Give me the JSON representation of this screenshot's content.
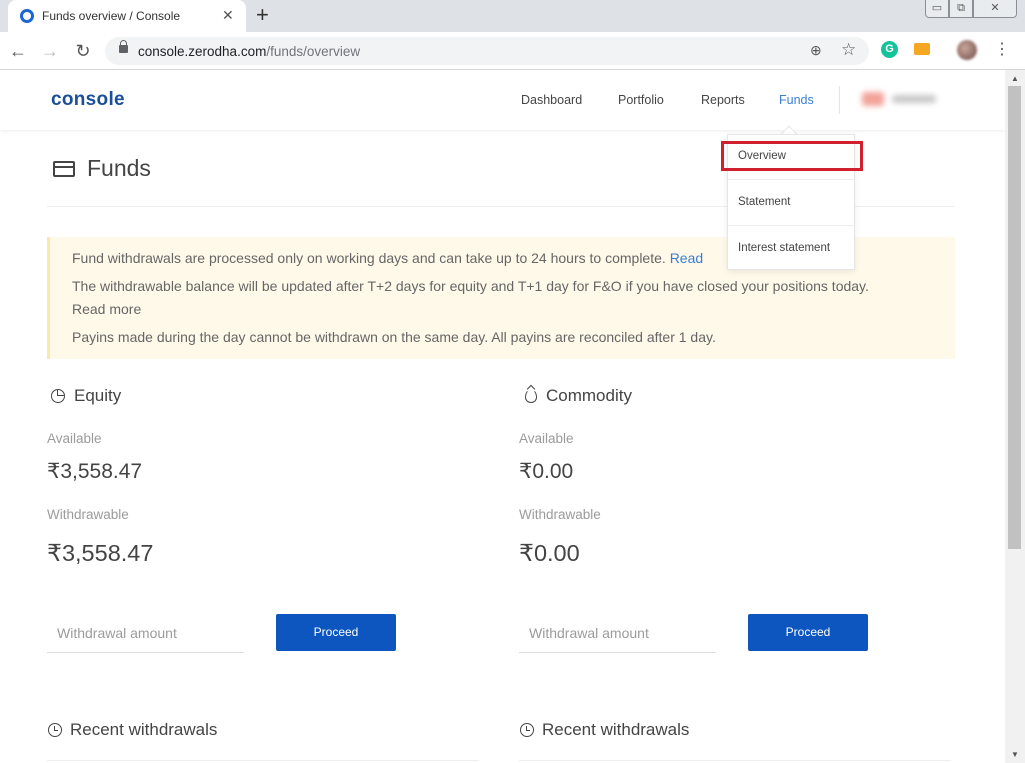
{
  "browser": {
    "tab_title": "Funds overview / Console",
    "tab_close": "✕",
    "new_tab": "+",
    "window_controls": {
      "minimize": "▭",
      "maximize": "⧉",
      "close": "✕"
    },
    "back": "←",
    "forward": "→",
    "reload": "↻",
    "url_host": "console.zerodha.com",
    "url_path": "/funds/overview",
    "zoom": "⊕",
    "star": "☆",
    "extension_g": "G",
    "menu": "⋮"
  },
  "nav": {
    "logo": "console",
    "links": [
      "Dashboard",
      "Portfolio",
      "Reports",
      "Funds"
    ],
    "active": "Funds"
  },
  "dropdown": {
    "items": [
      "Overview",
      "Statement",
      "Interest statement"
    ],
    "highlighted": "Overview",
    "highlight_color": "#d0202e"
  },
  "page": {
    "title": "Funds"
  },
  "notice": {
    "line1": "Fund withdrawals are processed only on working days and can take up to 24 hours to complete.",
    "line1_link": "Read",
    "line2": "The withdrawable balance will be updated after T+2 days for equity and T+1 day for F&O if you have closed your positions today.",
    "line2_link": "Read more",
    "line3": "Payins made during the day cannot be withdrawn on the same day. All payins are reconciled after 1 day."
  },
  "equity": {
    "title": "Equity",
    "available_label": "Available",
    "available": "₹3,558.47",
    "withdrawable_label": "Withdrawable",
    "withdrawable": "₹3,558.47",
    "input_placeholder": "Withdrawal amount",
    "button": "Proceed",
    "recent_title": "Recent withdrawals"
  },
  "commodity": {
    "title": "Commodity",
    "available_label": "Available",
    "available": "₹0.00",
    "withdrawable_label": "Withdrawable",
    "withdrawable": "₹0.00",
    "input_placeholder": "Withdrawal amount",
    "button": "Proceed",
    "recent_title": "Recent withdrawals"
  },
  "colors": {
    "brand": "#1c4f99",
    "link": "#387ed1",
    "button": "#0d56bf",
    "notice_bg": "#fff9ea"
  }
}
